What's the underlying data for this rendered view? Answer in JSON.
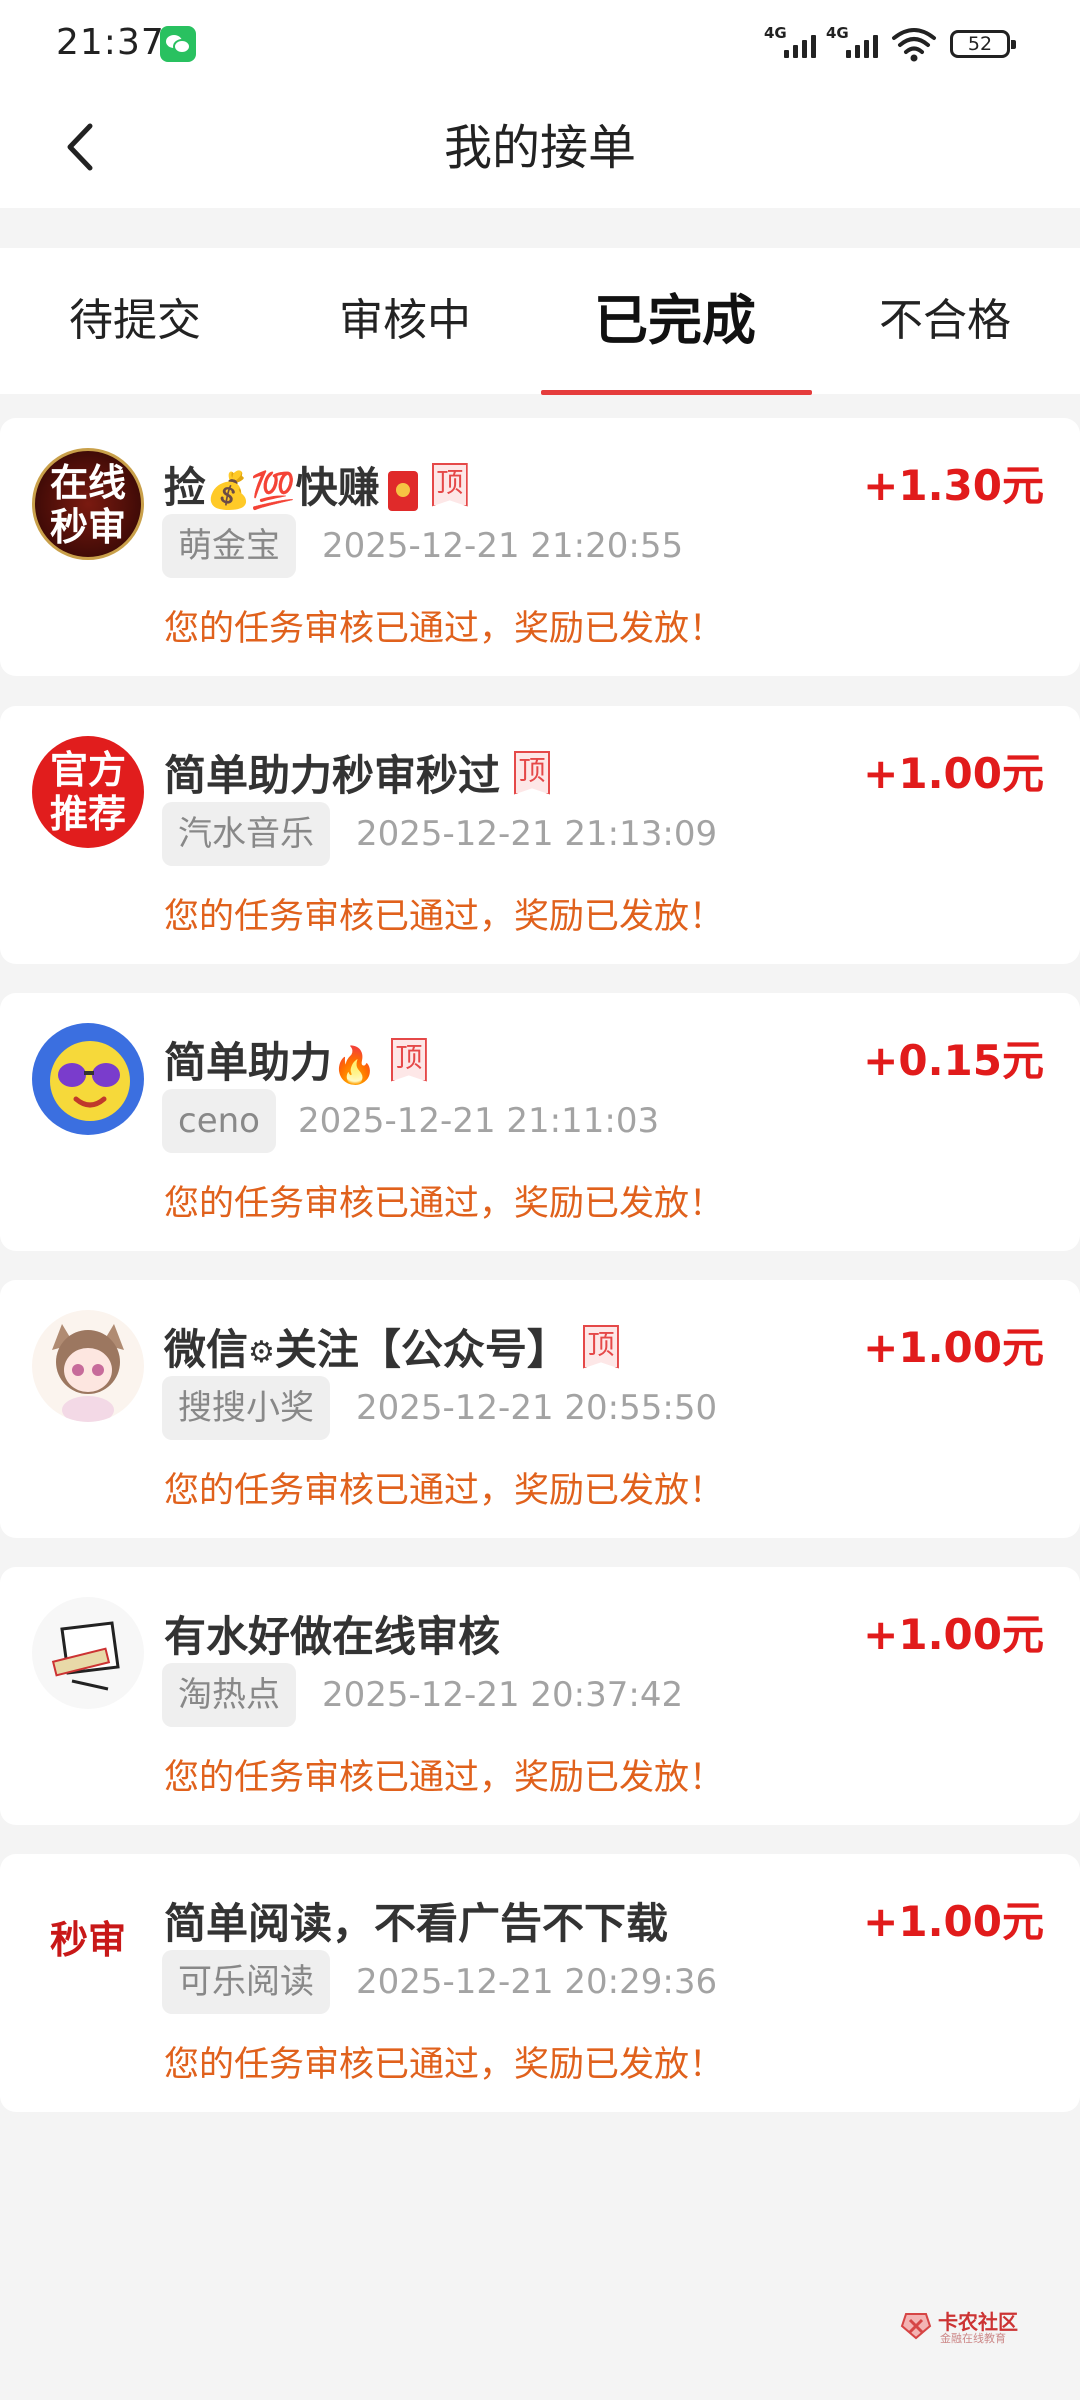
{
  "status_bar": {
    "time": "21:37",
    "network_1": "4G",
    "network_2": "4G",
    "battery": "52"
  },
  "nav": {
    "title": "我的接单",
    "back_icon": "chevron-left-icon"
  },
  "tabs": [
    {
      "label": "待提交",
      "active": false
    },
    {
      "label": "审核中",
      "active": false
    },
    {
      "label": "已完成",
      "active": true
    },
    {
      "label": "不合格",
      "active": false
    }
  ],
  "colors": {
    "accent": "#e53c3c",
    "reward": "#e11b1b",
    "status": "#e0611c"
  },
  "orders": [
    {
      "avatar_text_1": "在线",
      "avatar_text_2": "秒审",
      "title_a": "捡",
      "title_b": "快赚",
      "ding": "顶",
      "publisher": "萌金宝",
      "time": "2025-12-21 21:20:55",
      "reward": "+1.30元",
      "status": "您的任务审核已通过，奖励已发放！"
    },
    {
      "avatar_text_1": "官方",
      "avatar_text_2": "推荐",
      "title": "简单助力秒审秒过",
      "ding": "顶",
      "publisher": "汽水音乐",
      "time": "2025-12-21 21:13:09",
      "reward": "+1.00元",
      "status": "您的任务审核已通过，奖励已发放！"
    },
    {
      "title": "简单助力",
      "ding": "顶",
      "publisher": "ceno",
      "time": "2025-12-21 21:11:03",
      "reward": "+0.15元",
      "status": "您的任务审核已通过，奖励已发放！"
    },
    {
      "title_a": "微信",
      "title_b": "关注【公众号】",
      "ding": "顶",
      "publisher": "搜搜小奖",
      "time": "2025-12-21 20:55:50",
      "reward": "+1.00元",
      "status": "您的任务审核已通过，奖励已发放！"
    },
    {
      "title": "有水好做在线审核",
      "publisher": "淘热点",
      "time": "2025-12-21 20:37:42",
      "reward": "+1.00元",
      "status": "您的任务审核已通过，奖励已发放！"
    },
    {
      "avatar_text": "秒审",
      "title": "简单阅读，不看广告不下载",
      "publisher": "可乐阅读",
      "time": "2025-12-21 20:29:36",
      "reward": "+1.00元",
      "status": "您的任务审核已通过，奖励已发放！"
    }
  ],
  "watermark": {
    "name": "卡农社区",
    "sub": "金融在线教育"
  }
}
